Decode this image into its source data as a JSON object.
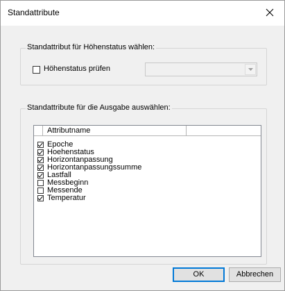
{
  "window": {
    "title": "Standattribute"
  },
  "group1": {
    "legend": "Standattribut für Höhenstatus wählen:",
    "checkbox_label": "Höhenstatus prüfen",
    "checkbox_checked": false,
    "combo_value": ""
  },
  "group2": {
    "legend": "Standattribute für die Ausgabe auswählen:",
    "columns": [
      "",
      "Attributname",
      ""
    ],
    "rows": [
      {
        "label": "Epoche",
        "checked": true
      },
      {
        "label": "Hoehenstatus",
        "checked": true
      },
      {
        "label": "Horizontanpassung",
        "checked": true
      },
      {
        "label": "Horizontanpassungssumme",
        "checked": true
      },
      {
        "label": "Lastfall",
        "checked": true
      },
      {
        "label": "Messbeginn",
        "checked": false
      },
      {
        "label": "Messende",
        "checked": false
      },
      {
        "label": "Temperatur",
        "checked": true
      }
    ]
  },
  "buttons": {
    "ok": "OK",
    "cancel": "Abbrechen"
  },
  "icons": {
    "close": "close-icon",
    "dropdown": "chevron-down-icon"
  }
}
